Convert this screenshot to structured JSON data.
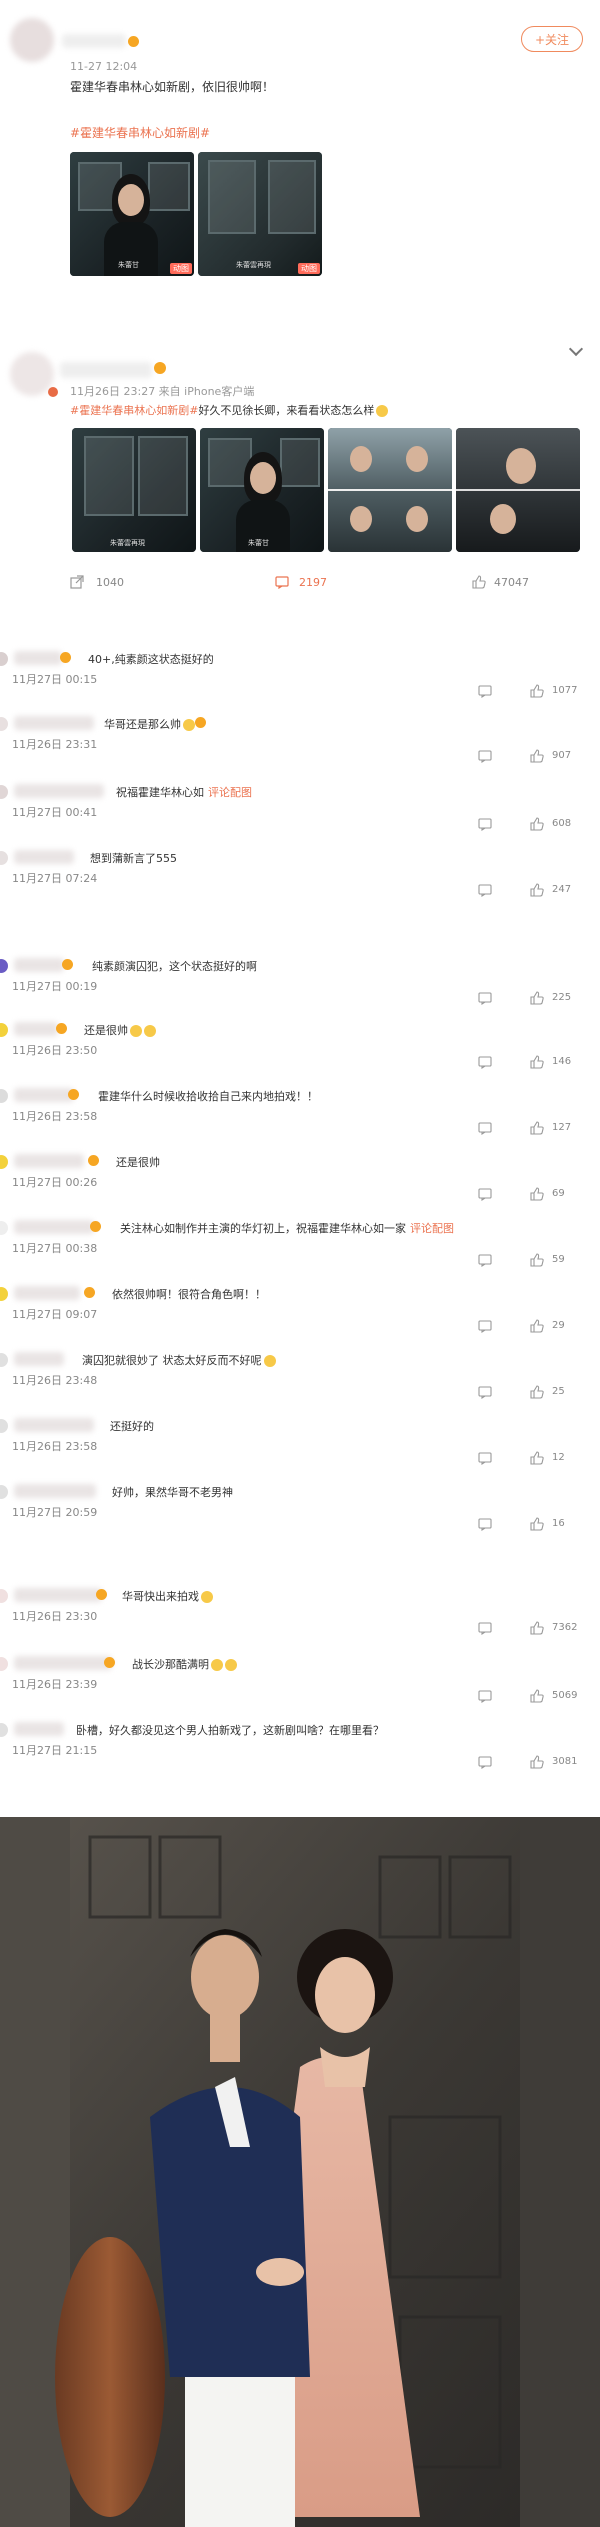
{
  "post1": {
    "time": "11-27 12:04",
    "follow_label": "+关注",
    "text": "霍建华春串林心如新剧，依旧很帅啊！",
    "hashtag": "#霍建华春串林心如新剧#",
    "images": [
      {
        "caption": "朱蕾甘",
        "badge": "动图"
      },
      {
        "caption": "朱蕾雲再現",
        "badge": "动图"
      }
    ]
  },
  "post2": {
    "time_source": "11月26日 23:27 来自 iPhone客户端",
    "hashtag": "#霍建华春串林心如新剧#",
    "text": "好久不见徐长卿，来看看状态怎么样",
    "images": [
      {
        "caption": "朱蕾雲再現"
      },
      {
        "caption": "朱蕾甘"
      },
      {
        "caption": ""
      },
      {
        "caption": ""
      }
    ],
    "actions": {
      "repost": "1040",
      "comment": "2197",
      "like": "47047"
    }
  },
  "comments": [
    {
      "text": "40+,纯素颜这状态挺好的",
      "time": "11月27日 00:15",
      "likes": "1077"
    },
    {
      "text": "华哥还是那么帅",
      "time": "11月26日 23:31",
      "likes": "907"
    },
    {
      "text": "祝福霍建华林心如",
      "link": "评论配图",
      "time": "11月27日 00:41",
      "likes": "608"
    },
    {
      "text": "想到蒲新言了555",
      "time": "11月27日 07:24",
      "likes": "247"
    },
    {
      "text": "纯素颜演囚犯，这个状态挺好的啊",
      "time": "11月27日 00:19",
      "likes": "225"
    },
    {
      "text": "还是很帅",
      "time": "11月26日 23:50",
      "likes": "146"
    },
    {
      "text": "霍建华什么时候收拾收拾自己来内地拍戏！！",
      "time": "11月26日 23:58",
      "likes": "127"
    },
    {
      "text": "还是很帅",
      "time": "11月27日 00:26",
      "likes": "69"
    },
    {
      "text": "关注林心如制作并主演的华灯初上，祝福霍建华林心如一家",
      "link": "评论配图",
      "time": "11月27日 00:38",
      "likes": "59"
    },
    {
      "text": "依然很帅啊！很符合角色啊！！",
      "time": "11月27日 09:07",
      "likes": "29"
    },
    {
      "text": "演囚犯就很妙了 状态太好反而不好呢",
      "time": "11月26日 23:48",
      "likes": "25"
    },
    {
      "text": "还挺好的",
      "time": "11月26日 23:58",
      "likes": "12"
    },
    {
      "text": "好帅，果然华哥不老男神",
      "time": "11月27日 20:59",
      "likes": "16"
    },
    {
      "text": "华哥快出来拍戏",
      "time": "11月26日 23:30",
      "likes": "7362"
    },
    {
      "text": "战长沙那酷满明",
      "time": "11月26日 23:39",
      "likes": "5069"
    },
    {
      "text": "卧槽，好久都没见这个男人拍新戏了，这新剧叫啥？在哪里看？",
      "time": "11月27日 21:15",
      "likes": "3081"
    }
  ],
  "colors": {
    "accent": "#eb7350",
    "follow": "#f08a5d"
  }
}
